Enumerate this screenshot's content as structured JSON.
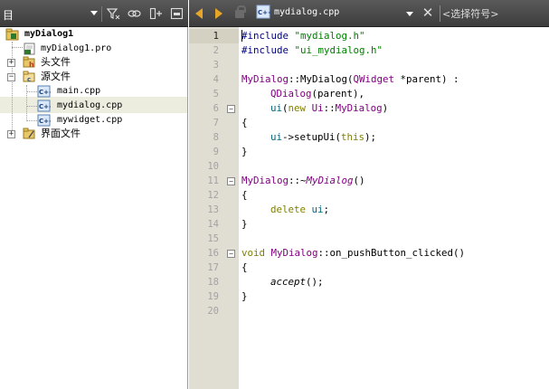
{
  "project_pane": {
    "title": "目",
    "toolbar": [
      "filter-icon",
      "link-icon",
      "split-icon",
      "close-pane-icon"
    ],
    "tree": {
      "root": "myDialog1",
      "pro_file": "myDialog1.pro",
      "headers_folder": "头文件",
      "sources_folder": "源文件",
      "sources": [
        "main.cpp",
        "mydialog.cpp",
        "mywidget.cpp"
      ],
      "forms_folder": "界面文件"
    }
  },
  "editor": {
    "current_file": "mydialog.cpp",
    "symbol_combo": "<选择符号>",
    "current_line": 1,
    "line_numbers": [
      "1",
      "2",
      "3",
      "4",
      "5",
      "6",
      "7",
      "8",
      "9",
      "10",
      "11",
      "12",
      "13",
      "14",
      "15",
      "16",
      "17",
      "18",
      "19",
      "20"
    ],
    "code": {
      "l1_pp": "#include",
      "l1_str": "\"mydialog.h\"",
      "l2_pp": "#include",
      "l2_str": "\"ui_mydialog.h\"",
      "l4_cls": "MyDialog",
      "l4_sep": "::MyDialog(",
      "l4_type": "QWidget",
      "l4_rest": " *parent) :",
      "l5_cls": "QDialog",
      "l5_rest": "(parent),",
      "l6_fn": "ui",
      "l6_p1": "(",
      "l6_kw": "new",
      "l6_sp": " ",
      "l6_ns": "Ui",
      "l6_sep": "::",
      "l6_cls": "MyDialog",
      "l6_p2": ")",
      "l7": "{",
      "l8_fn": "ui",
      "l8_rest": "->setupUi(",
      "l8_kw": "this",
      "l8_end": ");",
      "l9": "}",
      "l11_cls": "MyDialog",
      "l11_sep": "::~",
      "l11_it": "MyDialog",
      "l11_end": "()",
      "l12": "{",
      "l13_kw": "delete",
      "l13_sp": " ",
      "l13_fn": "ui",
      "l13_end": ";",
      "l14": "}",
      "l16_kw": "void",
      "l16_sp": " ",
      "l16_cls": "MyDialog",
      "l16_rest": "::on_pushButton_clicked()",
      "l17": "{",
      "l18_it": "accept",
      "l18_end": "();",
      "l19": "}"
    }
  }
}
